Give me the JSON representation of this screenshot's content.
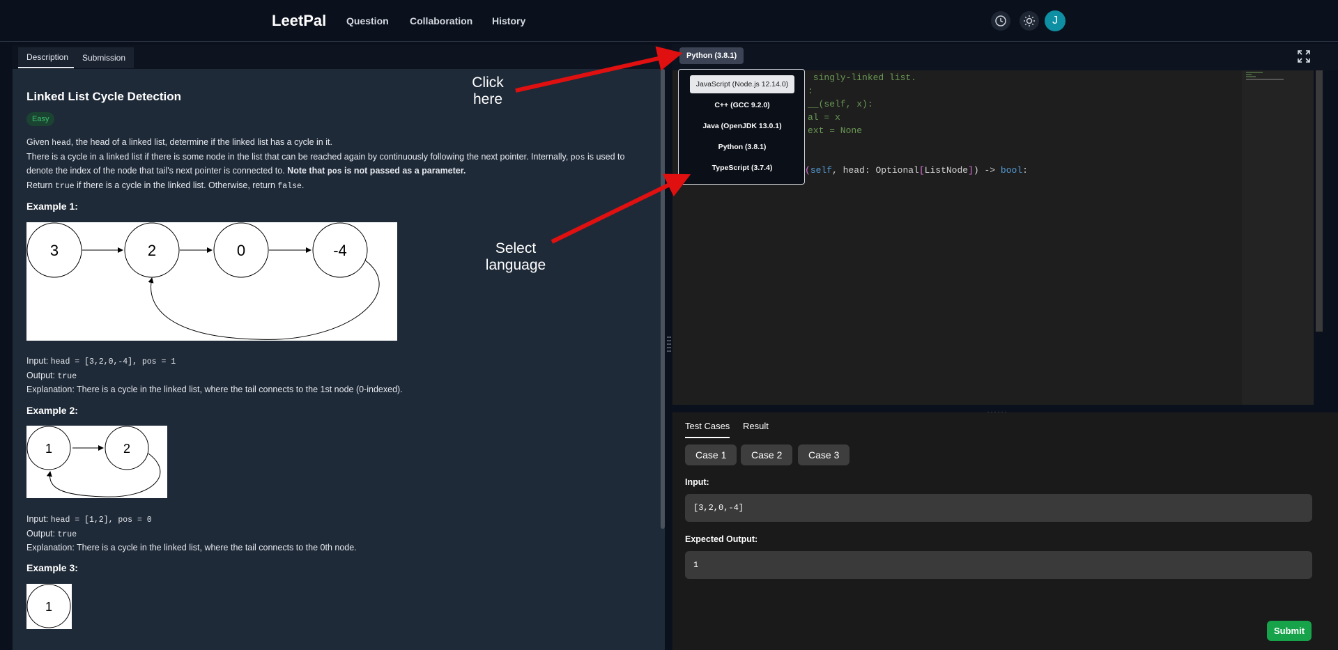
{
  "nav": {
    "brand": "LeetPal",
    "links": [
      "Question",
      "Collaboration",
      "History"
    ],
    "avatar_initial": "J"
  },
  "left": {
    "tabs": [
      "Description",
      "Submission"
    ],
    "title": "Linked List Cycle Detection",
    "difficulty": "Easy",
    "desc": {
      "p1_a": "Given ",
      "p1_code": "head",
      "p1_b": ", the head of a linked list, determine if the linked list has a cycle in it.",
      "p2_a": "There is a cycle in a linked list if there is some node in the list that can be reached again by continuously following the next pointer. Internally, ",
      "p2_code": "pos",
      "p2_b": " is used to denote the index of the node that tail's next pointer is connected to. ",
      "p2_bold_a": "Note that ",
      "p2_bold_code": "pos",
      "p2_bold_b": " is not passed as a parameter.",
      "p3_a": "Return ",
      "p3_code1": "true",
      "p3_b": " if there is a cycle in the linked list. Otherwise, return ",
      "p3_code2": "false",
      "p3_c": "."
    },
    "examples": [
      {
        "heading": "Example 1:",
        "nodes": [
          "3",
          "2",
          "0",
          "-4"
        ],
        "input_label": "Input: ",
        "input_code": "head = [3,2,0,-4], pos = 1",
        "output_label": "Output: ",
        "output_code": "true",
        "explanation": "Explanation: There is a cycle in the linked list, where the tail connects to the 1st node (0-indexed)."
      },
      {
        "heading": "Example 2:",
        "nodes": [
          "1",
          "2"
        ],
        "input_label": "Input: ",
        "input_code": "head = [1,2], pos = 0",
        "output_label": "Output: ",
        "output_code": "true",
        "explanation": "Explanation: There is a cycle in the linked list, where the tail connects to the 0th node."
      },
      {
        "heading": "Example 3:",
        "nodes": [
          "1"
        ]
      }
    ]
  },
  "editor": {
    "language_button": "Python (3.8.1)",
    "languages": [
      "JavaScript (Node.js 12.14.0)",
      "C++ (GCC 9.2.0)",
      "Java (OpenJDK 13.0.1)",
      "Python (3.8.1)",
      "TypeScript (3.7.4)"
    ],
    "highlighted_language": "JavaScript (Node.js 12.14.0)",
    "code": {
      "line1": " singly-linked list.",
      "line2": ":",
      "line3": "__(self, x):",
      "line4": "al = x",
      "line5": "ext = None",
      "line6_a": "(",
      "line6_self": "self",
      "line6_b": ", head: Optional",
      "line6_br1": "[",
      "line6_c": "ListNode",
      "line6_br2": "]",
      "line6_d": ") -> ",
      "line6_bool": "bool",
      "line6_e": ":"
    }
  },
  "bottom": {
    "tabs": [
      "Test Cases",
      "Result"
    ],
    "cases": [
      "Case 1",
      "Case 2",
      "Case 3"
    ],
    "input_label": "Input:",
    "input_value": "[3,2,0,-4]",
    "expected_label": "Expected Output:",
    "expected_value": "1",
    "submit_label": "Submit"
  },
  "annotations": {
    "click_line1": "Click",
    "click_line2": "here",
    "select_line1": "Select",
    "select_line2": "language"
  },
  "colors": {
    "accent_green": "#16a34a",
    "avatar": "#0e8fa3",
    "arrow": "#e01010"
  }
}
